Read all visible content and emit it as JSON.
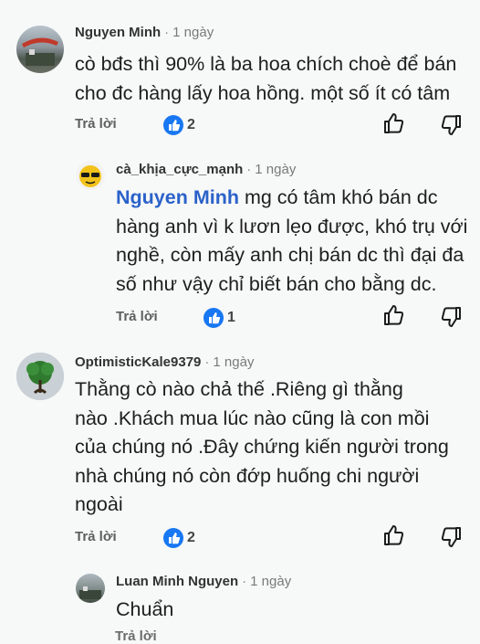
{
  "comments": [
    {
      "author": "Nguyen Minh",
      "time": "1 ngày",
      "text": "cò bđs thì 90% là ba hoa chích choè để bán\ncho đc hàng lấy hoa hồng. một số ít có tâm",
      "reply_label": "Trả lời",
      "like_count": "2"
    },
    {
      "author": "cà_khịa_cực_mạnh",
      "time": "1 ngày",
      "mention": "Nguyen Minh",
      "text": " mg có tâm khó bán dc\nhàng anh vì k lươn lẹo được, khó trụ với\nnghề, còn mấy anh chị bán dc thì đại đa\nsố như vậy chỉ biết bán cho bằng dc.",
      "reply_label": "Trả lời",
      "like_count": "1"
    },
    {
      "author": "OptimisticKale9379",
      "time": "1 ngày",
      "text": "Thằng cò nào chả thế .Riêng gì thằng\nnào .Khách mua lúc nào cũng là con mồi\ncủa chúng nó .Đây chứng kiến người trong\nnhà chúng nó còn đớp huống chi người\nngoài",
      "reply_label": "Trả lời",
      "like_count": "2"
    },
    {
      "author": "Luan Minh Nguyen",
      "time": "1 ngày",
      "text": "Chuẩn",
      "reply_label": "Trả lời"
    }
  ],
  "colors": {
    "reaction_blue": "#1877f2",
    "mention_blue": "#2b62c9",
    "background": "#f7f8f8"
  },
  "icons": [
    "like-reaction-icon",
    "thumbs-up-icon",
    "thumbs-down-icon"
  ]
}
